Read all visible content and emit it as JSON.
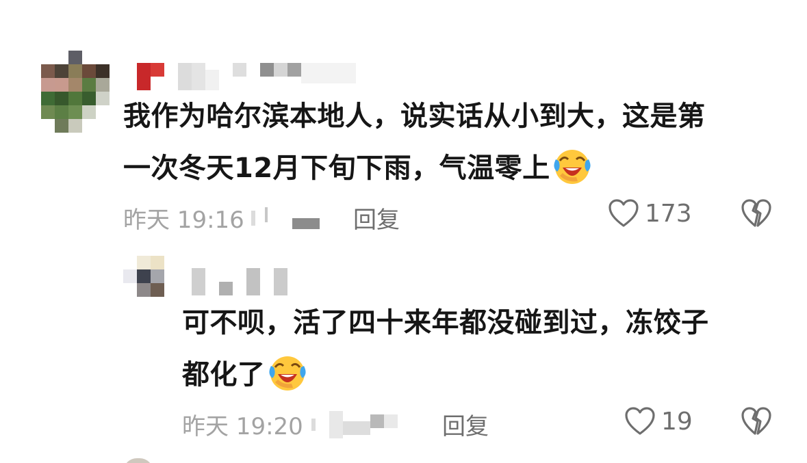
{
  "comments": [
    {
      "text_line1": "我作为哈尔滨本地人，说实话从小到大，这是第",
      "text_line2": "一次冬天12月下旬下雨，气温零上",
      "emoji": "laughing-crying-emoji",
      "time": "昨天 19:16",
      "reply_label": "回复",
      "like_count": "173",
      "like_icon": "heart-outline-icon",
      "dislike_icon": "broken-heart-icon"
    },
    {
      "text_line1": "可不呗，活了四十来年都没碰到过，冻饺子",
      "text_line2": "都化了",
      "emoji": "laughing-crying-emoji",
      "time": "昨天 19:20",
      "reply_label": "回复",
      "like_count": "19",
      "like_icon": "heart-outline-icon",
      "dislike_icon": "broken-heart-icon"
    }
  ],
  "colors": {
    "text": "#161616",
    "meta": "#a3a3a3",
    "action": "#6e6e6e",
    "background": "#ffffff"
  }
}
